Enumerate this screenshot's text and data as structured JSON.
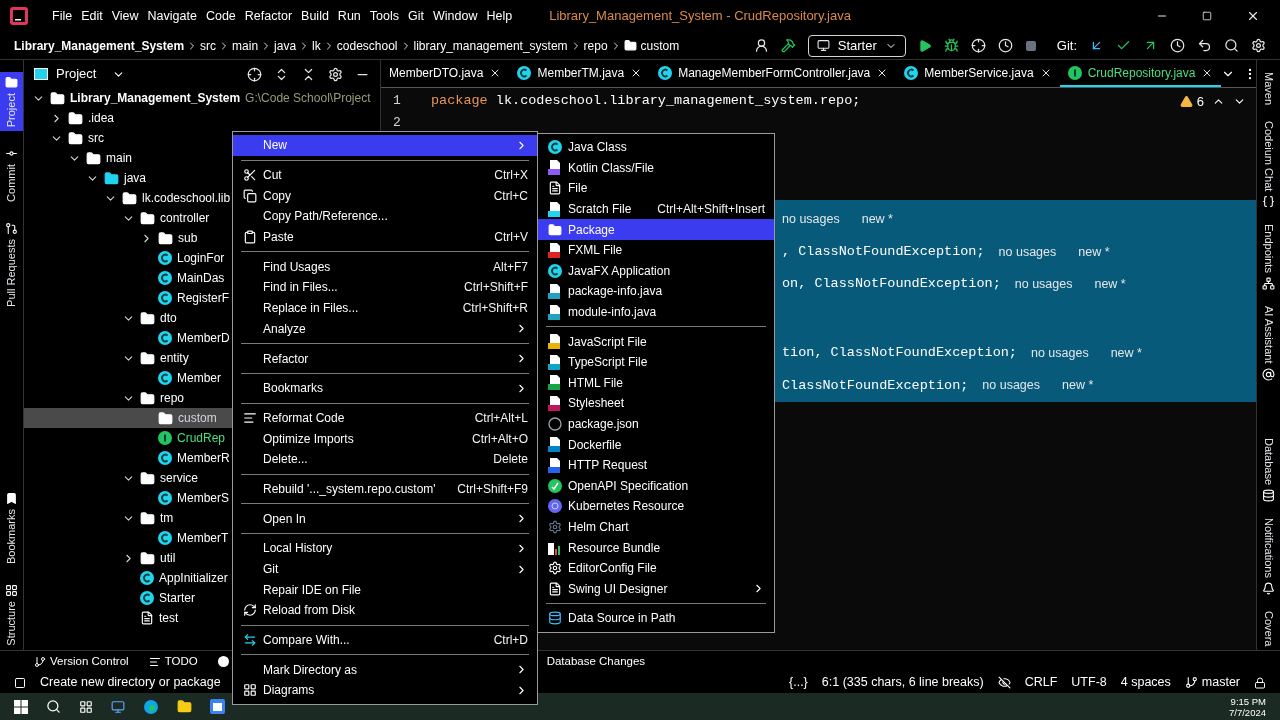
{
  "menu_bar": {
    "items": [
      "File",
      "Edit",
      "View",
      "Navigate",
      "Code",
      "Refactor",
      "Build",
      "Run",
      "Tools",
      "Git",
      "Window",
      "Help"
    ],
    "title": "Library_Management_System - CrudRepository.java"
  },
  "breadcrumbs": [
    "Library_Management_System",
    "src",
    "main",
    "java",
    "lk",
    "codeschool",
    "library_management_system",
    "repo",
    "custom"
  ],
  "toolbar": {
    "run_config": "Starter",
    "git_label": "Git:"
  },
  "left_strip": [
    {
      "label": "Project",
      "selected": true
    },
    {
      "label": "Commit",
      "selected": false
    },
    {
      "label": "Pull Requests",
      "selected": false
    },
    {
      "label": "Bookmarks",
      "selected": false
    },
    {
      "label": "Structure",
      "selected": false
    }
  ],
  "right_strip": [
    "Maven",
    "Codeium Chat",
    "Endpoints",
    "AI Assistant",
    "Database",
    "Notifications",
    "Covera"
  ],
  "project_panel": {
    "title": "Project",
    "tree": [
      {
        "label": "Library_Management_System",
        "path": "G:\\Code School\\Project",
        "kind": "module",
        "expanded": true,
        "selected": false,
        "children": [
          {
            "label": ".idea",
            "kind": "folder",
            "expanded": false,
            "selected": false
          },
          {
            "label": "src",
            "kind": "folder",
            "expanded": true,
            "selected": false,
            "children": [
              {
                "label": "main",
                "kind": "folder",
                "expanded": true,
                "selected": false,
                "children": [
                  {
                    "label": "java",
                    "kind": "source",
                    "expanded": true,
                    "selected": false,
                    "children": [
                      {
                        "label": "lk.codeschool.lib",
                        "kind": "package",
                        "expanded": true,
                        "selected": false,
                        "children": [
                          {
                            "label": "controller",
                            "kind": "package",
                            "expanded": true,
                            "selected": false,
                            "children": [
                              {
                                "label": "sub",
                                "kind": "package",
                                "expanded": false,
                                "selected": false
                              },
                              {
                                "label": "LoginFor",
                                "kind": "class",
                                "selected": false
                              },
                              {
                                "label": "MainDas",
                                "kind": "class",
                                "selected": false
                              },
                              {
                                "label": "RegisterF",
                                "kind": "class",
                                "selected": false
                              }
                            ]
                          },
                          {
                            "label": "dto",
                            "kind": "package",
                            "expanded": true,
                            "selected": false,
                            "children": [
                              {
                                "label": "MemberD",
                                "kind": "class",
                                "selected": false
                              }
                            ]
                          },
                          {
                            "label": "entity",
                            "kind": "package",
                            "expanded": true,
                            "selected": false,
                            "children": [
                              {
                                "label": "Member",
                                "kind": "class",
                                "selected": false
                              }
                            ]
                          },
                          {
                            "label": "repo",
                            "kind": "package",
                            "expanded": true,
                            "selected": false,
                            "children": [
                              {
                                "label": "custom",
                                "kind": "package",
                                "selected": true
                              },
                              {
                                "label": "CrudRep",
                                "kind": "interface",
                                "selected": false
                              },
                              {
                                "label": "MemberR",
                                "kind": "class",
                                "selected": false
                              }
                            ]
                          },
                          {
                            "label": "service",
                            "kind": "package",
                            "expanded": true,
                            "selected": false,
                            "children": [
                              {
                                "label": "MemberS",
                                "kind": "class",
                                "selected": false
                              }
                            ]
                          },
                          {
                            "label": "tm",
                            "kind": "package",
                            "expanded": true,
                            "selected": false,
                            "children": [
                              {
                                "label": "MemberT",
                                "kind": "class",
                                "selected": false
                              }
                            ]
                          },
                          {
                            "label": "util",
                            "kind": "package",
                            "expanded": false,
                            "selected": false
                          },
                          {
                            "label": "AppInitializer",
                            "kind": "class",
                            "selected": false
                          },
                          {
                            "label": "Starter",
                            "kind": "class",
                            "selected": false
                          },
                          {
                            "label": "test",
                            "kind": "file",
                            "selected": false
                          }
                        ]
                      }
                    ]
                  }
                ]
              }
            ]
          }
        ]
      }
    ]
  },
  "tabs": [
    {
      "label": "MemberDTO.java",
      "selected": false
    },
    {
      "label": "MemberTM.java",
      "kind": "class",
      "selected": false
    },
    {
      "label": "ManageMemberFormController.java",
      "kind": "class",
      "selected": false
    },
    {
      "label": "MemberService.java",
      "kind": "class",
      "selected": false
    },
    {
      "label": "CrudRepository.java",
      "kind": "interface",
      "selected": true
    }
  ],
  "editor": {
    "line_numbers": [
      "1",
      "2"
    ],
    "keyword": "package",
    "line_1": "lk.codeschool.library_management_system.repo;",
    "warnings": "6",
    "hint_lines": [
      {
        "usages": "no usages",
        "author": "new *"
      },
      {
        "code": ", ClassNotFoundException;",
        "usages": "no usages",
        "author": "new *"
      },
      {
        "code": "on, ClassNotFoundException;",
        "usages": "no usages",
        "author": "new *"
      },
      {
        "code": "tion, ClassNotFoundException;",
        "usages": "no usages",
        "author": "new *"
      },
      {
        "code": "ClassNotFoundException;",
        "usages": "no usages",
        "author": "new *"
      }
    ]
  },
  "context_menu": [
    {
      "kind": "item",
      "label": "New",
      "submenu": true,
      "selected": true
    },
    {
      "kind": "separator"
    },
    {
      "kind": "item",
      "label": "Cut",
      "shortcut": "Ctrl+X",
      "selected": false
    },
    {
      "kind": "item",
      "label": "Copy",
      "shortcut": "Ctrl+C",
      "selected": false
    },
    {
      "kind": "item",
      "label": "Copy Path/Reference...",
      "selected": false
    },
    {
      "kind": "item",
      "label": "Paste",
      "shortcut": "Ctrl+V",
      "selected": false
    },
    {
      "kind": "separator"
    },
    {
      "kind": "item",
      "label": "Find Usages",
      "shortcut": "Alt+F7",
      "selected": false
    },
    {
      "kind": "item",
      "label": "Find in Files...",
      "shortcut": "Ctrl+Shift+F",
      "selected": false
    },
    {
      "kind": "item",
      "label": "Replace in Files...",
      "shortcut": "Ctrl+Shift+R",
      "selected": false
    },
    {
      "kind": "item",
      "label": "Analyze",
      "submenu": true,
      "selected": false
    },
    {
      "kind": "separator"
    },
    {
      "kind": "item",
      "label": "Refactor",
      "submenu": true,
      "selected": false
    },
    {
      "kind": "separator"
    },
    {
      "kind": "item",
      "label": "Bookmarks",
      "submenu": true,
      "selected": false
    },
    {
      "kind": "separator"
    },
    {
      "kind": "item",
      "label": "Reformat Code",
      "shortcut": "Ctrl+Alt+L",
      "selected": false
    },
    {
      "kind": "item",
      "label": "Optimize Imports",
      "shortcut": "Ctrl+Alt+O",
      "selected": false
    },
    {
      "kind": "item",
      "label": "Delete...",
      "shortcut": "Delete",
      "selected": false
    },
    {
      "kind": "separator"
    },
    {
      "kind": "item",
      "label": "Rebuild '..._system.repo.custom'",
      "shortcut": "Ctrl+Shift+F9",
      "selected": false
    },
    {
      "kind": "separator"
    },
    {
      "kind": "item",
      "label": "Open In",
      "submenu": true,
      "selected": false
    },
    {
      "kind": "separator"
    },
    {
      "kind": "item",
      "label": "Local History",
      "submenu": true,
      "selected": false
    },
    {
      "kind": "item",
      "label": "Git",
      "submenu": true,
      "selected": false
    },
    {
      "kind": "item",
      "label": "Repair IDE on File",
      "selected": false
    },
    {
      "kind": "item",
      "label": "Reload from Disk",
      "selected": false
    },
    {
      "kind": "separator"
    },
    {
      "kind": "item",
      "label": "Compare With...",
      "shortcut": "Ctrl+D",
      "selected": false
    },
    {
      "kind": "separator"
    },
    {
      "kind": "item",
      "label": "Mark Directory as",
      "submenu": true,
      "selected": false
    },
    {
      "kind": "item",
      "label": "Diagrams",
      "submenu": true,
      "selected": false
    }
  ],
  "new_submenu": [
    {
      "kind": "item",
      "label": "Java Class",
      "selected": false
    },
    {
      "kind": "item",
      "label": "Kotlin Class/File",
      "selected": false
    },
    {
      "kind": "item",
      "label": "File",
      "selected": false
    },
    {
      "kind": "item",
      "label": "Scratch File",
      "shortcut": "Ctrl+Alt+Shift+Insert",
      "selected": false
    },
    {
      "kind": "item",
      "label": "Package",
      "selected": true
    },
    {
      "kind": "item",
      "label": "FXML File",
      "selected": false
    },
    {
      "kind": "item",
      "label": "JavaFX Application",
      "selected": false
    },
    {
      "kind": "item",
      "label": "package-info.java",
      "selected": false
    },
    {
      "kind": "item",
      "label": "module-info.java",
      "selected": false
    },
    {
      "kind": "separator"
    },
    {
      "kind": "item",
      "label": "JavaScript File",
      "selected": false
    },
    {
      "kind": "item",
      "label": "TypeScript File",
      "selected": false
    },
    {
      "kind": "item",
      "label": "HTML File",
      "selected": false
    },
    {
      "kind": "item",
      "label": "Stylesheet",
      "selected": false
    },
    {
      "kind": "item",
      "label": "package.json",
      "selected": false
    },
    {
      "kind": "item",
      "label": "Dockerfile",
      "selected": false
    },
    {
      "kind": "item",
      "label": "HTTP Request",
      "selected": false
    },
    {
      "kind": "item",
      "label": "OpenAPI Specification",
      "selected": false
    },
    {
      "kind": "item",
      "label": "Kubernetes Resource",
      "selected": false
    },
    {
      "kind": "item",
      "label": "Helm Chart",
      "selected": false
    },
    {
      "kind": "item",
      "label": "Resource Bundle",
      "selected": false
    },
    {
      "kind": "item",
      "label": "EditorConfig File",
      "selected": false
    },
    {
      "kind": "item",
      "label": "Swing UI Designer",
      "submenu": true,
      "selected": false
    },
    {
      "kind": "separator"
    },
    {
      "kind": "item",
      "label": "Data Source in Path",
      "selected": false
    }
  ],
  "tool_window_bar": [
    "Version Control",
    "TODO",
    "Database Changes"
  ],
  "status_bar": {
    "message": "Create new directory or package",
    "braces": "{...}",
    "position": "6:1 (335 chars, 6 line breaks)",
    "line_separator": "CRLF",
    "encoding": "UTF-8",
    "indent": "4 spaces",
    "branch": "master"
  },
  "taskbar": {
    "time": "9:15 PM",
    "date": "7/7/2024"
  }
}
